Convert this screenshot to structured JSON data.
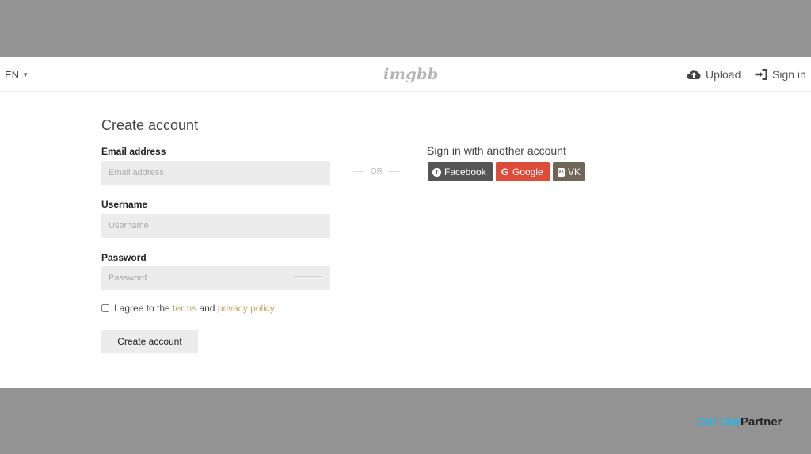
{
  "colors": {
    "outer_bg": "#939393",
    "facebook": "#555555",
    "google": "#dd4b39",
    "vk": "#6f6657",
    "link": "#c5a96c",
    "watermark_accent": "#23b7e5"
  },
  "header": {
    "language": "EN",
    "language_icon": "chevron-down-icon",
    "logo": "imgbb",
    "upload_label": "Upload",
    "upload_icon": "cloud-upload-icon",
    "signin_label": "Sign in",
    "signin_icon": "sign-in-icon"
  },
  "form": {
    "title": "Create account",
    "email": {
      "label": "Email address",
      "placeholder": "Email address",
      "value": ""
    },
    "username": {
      "label": "Username",
      "placeholder": "Username",
      "value": ""
    },
    "password": {
      "label": "Password",
      "placeholder": "Password",
      "value": ""
    },
    "agree": {
      "prefix": "I agree to the",
      "terms": "terms",
      "and": "and",
      "privacy": "privacy policy"
    },
    "submit_label": "Create account"
  },
  "separator": {
    "label": "OR"
  },
  "alt": {
    "title": "Sign in with another account",
    "buttons": [
      {
        "label": "Facebook",
        "icon": "facebook-icon"
      },
      {
        "label": "Google",
        "icon": "google-icon"
      },
      {
        "label": "VK",
        "icon": "vk-icon"
      }
    ]
  },
  "watermark": {
    "part_a": "Cut Out",
    "part_b": "Partner"
  }
}
